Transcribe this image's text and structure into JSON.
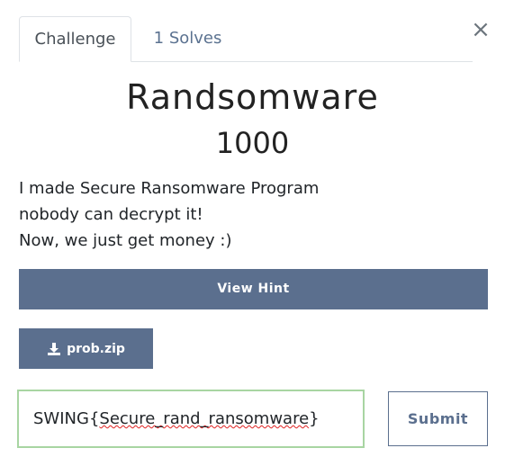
{
  "tabs": {
    "challenge": "Challenge",
    "solves": "1 Solves"
  },
  "close_label": "×",
  "challenge": {
    "name": "Randsomware",
    "value": "1000",
    "description": [
      "I made Secure Ransomware Program",
      "nobody can decrypt it!",
      "Now, we just get money :)"
    ]
  },
  "buttons": {
    "hint": "View Hint",
    "file": "prob.zip",
    "submit": "Submit"
  },
  "flag_input": {
    "prefix": "SWING{",
    "misspelled": "Secure_rand_ransomware",
    "suffix": "}"
  },
  "colors": {
    "button_bg": "#5b6f8e",
    "input_border_valid": "#a8d5a2",
    "tab_link": "#5b7290"
  },
  "icons": {
    "file_button": "download-icon",
    "close": "close-icon"
  }
}
